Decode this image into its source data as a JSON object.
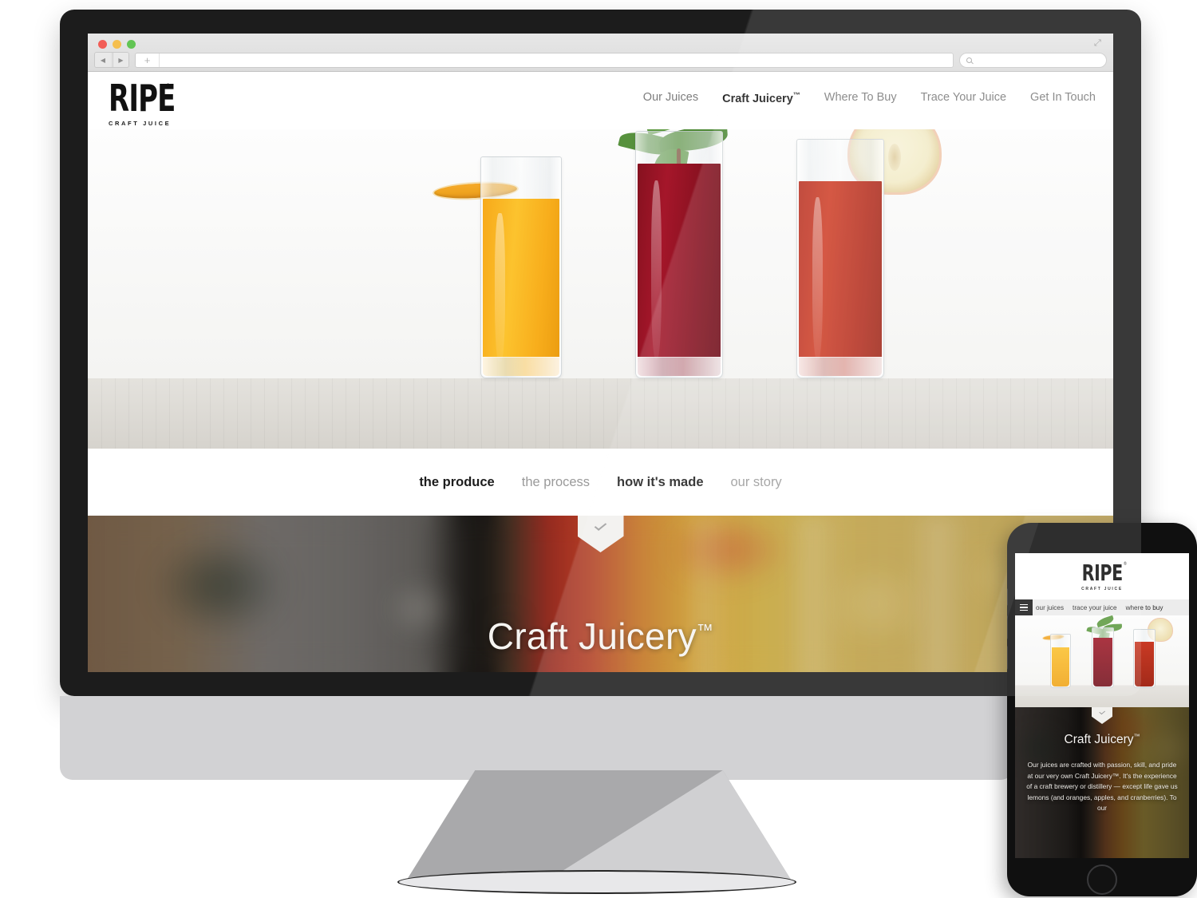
{
  "browser": {
    "back_icon": "◀",
    "forward_icon": "▶",
    "new_tab_label": "+",
    "search_placeholder": "",
    "search_value": "",
    "search_icon": "search-icon",
    "expand_icon": "⤢",
    "traffic_lights": [
      "#f25d56",
      "#f5bf4f",
      "#62c554"
    ]
  },
  "site": {
    "logo": {
      "mark": "RIPE",
      "tm": "®",
      "tagline": "CRAFT JUICE"
    },
    "nav": [
      {
        "label": "Our Juices",
        "active": false
      },
      {
        "label": "Craft Juicery",
        "tm": "™",
        "active": true
      },
      {
        "label": "Where To Buy",
        "active": false
      },
      {
        "label": "Trace Your Juice",
        "active": false
      },
      {
        "label": "Get In Touch",
        "active": false
      }
    ],
    "subnav": [
      {
        "label": "the produce",
        "active": true
      },
      {
        "label": "the process",
        "active": false
      },
      {
        "label": "how it's made",
        "active": true
      },
      {
        "label": "our story",
        "active": false
      }
    ],
    "hero": {
      "glasses": [
        {
          "juice": "orange juice",
          "color": "#f8b01e",
          "garnish": "orange slice"
        },
        {
          "juice": "beet juice",
          "color": "#8c1321",
          "garnish": "mint sprig"
        },
        {
          "juice": "cranberry juice",
          "color": "#c13724",
          "garnish": "apple slice"
        }
      ]
    },
    "band": {
      "title": "Craft Juicery",
      "tm": "™",
      "scroll_hint": "chevron-down"
    }
  },
  "phone": {
    "logo": {
      "mark": "RIPE",
      "tm": "®",
      "tagline": "CRAFT JUICE"
    },
    "nav": [
      {
        "label": "our juices"
      },
      {
        "label": "trace your juice"
      },
      {
        "label": "where to buy"
      }
    ],
    "menu_icon": "hamburger-icon",
    "band": {
      "title": "Craft Juicery",
      "tm": "™",
      "body": "Our juices are crafted with passion, skill, and pride at our very own Craft Juicery™. It's the experience of a craft brewery or distillery — except life gave us lemons (and oranges, apples, and cranberries). To our"
    }
  }
}
